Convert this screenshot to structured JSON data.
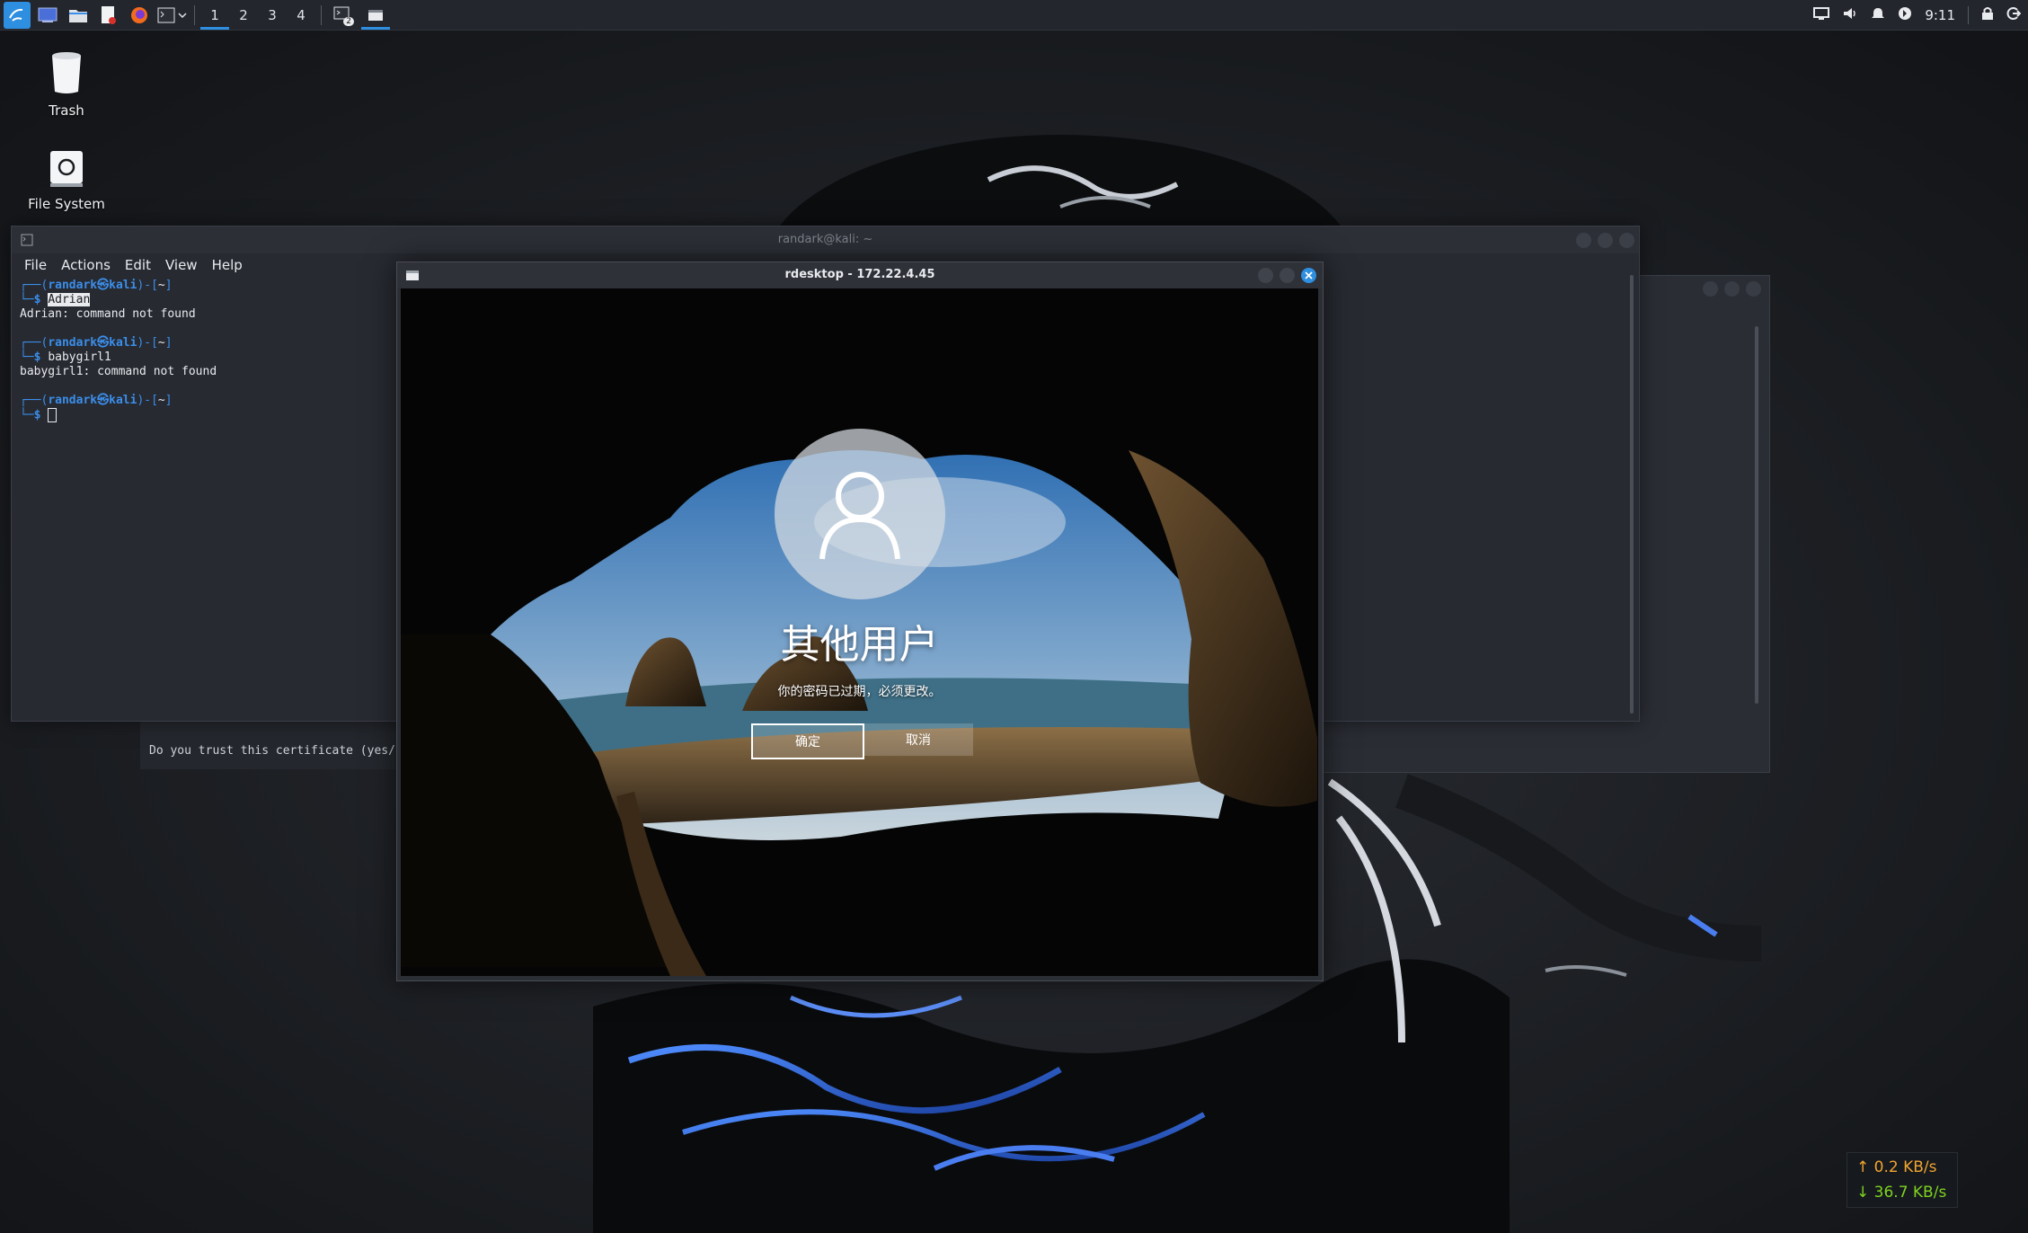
{
  "taskbar": {
    "workspaces": [
      "1",
      "2",
      "3",
      "4"
    ],
    "active_workspace": "1",
    "terminal_badge": "2",
    "clock": "9:11"
  },
  "desktop": {
    "icons": [
      {
        "label": "Trash",
        "icon": "trash-icon"
      },
      {
        "label": "File System",
        "icon": "drive-icon"
      }
    ]
  },
  "terminal": {
    "title": "randark@kali: ~",
    "menu": [
      "File",
      "Actions",
      "Edit",
      "View",
      "Help"
    ],
    "user": "randark",
    "host": "kali",
    "dir": "~",
    "commands": [
      {
        "cmd": "Adrian",
        "output": "Adrian: command not found"
      },
      {
        "cmd": "babygirl1",
        "output": "babygirl1: command not found"
      }
    ]
  },
  "cert_terminal": {
    "prompt": "Do you trust this certificate (yes/no)?"
  },
  "rdesktop": {
    "title": "rdesktop - 172.22.4.45",
    "user_name": "其他用户",
    "message": "你的密码已过期，必须更改。",
    "ok_label": "确定",
    "cancel_label": "取消"
  },
  "netspeed": {
    "up": "0.2 KB/s",
    "down": "36.7 KB/s"
  },
  "colors": {
    "accent": "#2e8ee0",
    "prompt_blue": "#3b8eea",
    "net_up": "#f0a531",
    "net_down": "#7ed321"
  }
}
